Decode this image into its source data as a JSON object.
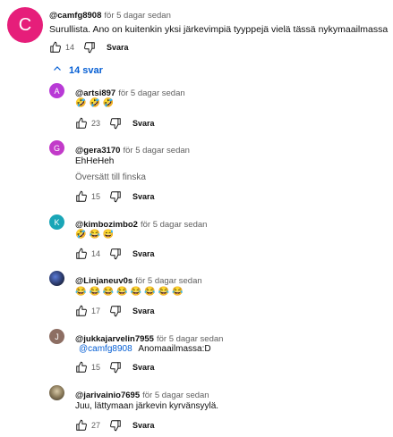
{
  "colors": {
    "avatar_c": "#e61e7a",
    "avatar_a": "#b83ad6",
    "avatar_g": "#c23ac9",
    "avatar_k": "#1aa6b7",
    "avatar_j": "#8d6e63",
    "link": "#065fd4"
  },
  "top_comment": {
    "avatar_letter": "C",
    "handle": "@camfg8908",
    "time": "för 5 dagar sedan",
    "text": "Surullista. Ano on kuitenkin yksi järkevimpiä tyyppejä vielä tässä nykymaailmassa",
    "likes": "14",
    "reply_label": "Svara"
  },
  "replies_toggle": {
    "icon": "chevron-up-icon",
    "label": "14 svar"
  },
  "replies": [
    {
      "avatar_letter": "A",
      "handle": "@artsi897",
      "time": "för 5 dagar sedan",
      "text": "🤣🤣🤣",
      "likes": "23",
      "reply_label": "Svara"
    },
    {
      "avatar_letter": "G",
      "handle": "@gera3170",
      "time": "för 5 dagar sedan",
      "text": "EhHeHeh",
      "translate": "Översätt till finska",
      "likes": "15",
      "reply_label": "Svara"
    },
    {
      "avatar_letter": "K",
      "handle": "@kimbozimbo2",
      "time": "för 5 dagar sedan",
      "text": "🤣😂😅",
      "likes": "14",
      "reply_label": "Svara"
    },
    {
      "handle": "@Linjaneuv0s",
      "time": "för 5 dagar sedan",
      "text": "😂😂😂😂😂😂😂😂",
      "likes": "17",
      "reply_label": "Svara"
    },
    {
      "avatar_letter": "J",
      "handle": "@jukkajarvelin7955",
      "time": "för 5 dagar sedan",
      "mention": "@camfg8908",
      "text": "Anomaailmassa:D",
      "likes": "15",
      "reply_label": "Svara"
    },
    {
      "handle": "@jarivainio7695",
      "time": "för 5 dagar sedan",
      "text": "Juu, lättymaan järkevin kyrvänsyylä.",
      "likes": "27",
      "reply_label": "Svara"
    }
  ]
}
